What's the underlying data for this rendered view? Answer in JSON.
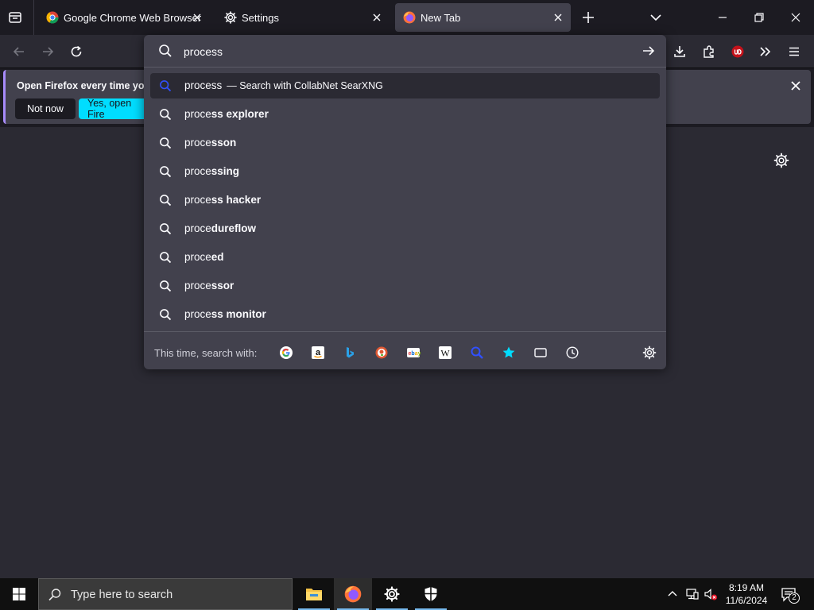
{
  "tabs": [
    {
      "title": "Google Chrome Web Browser",
      "icon": "chrome-icon",
      "active": false
    },
    {
      "title": "Settings",
      "icon": "gear-icon",
      "active": false
    },
    {
      "title": "New Tab",
      "icon": "firefox-icon",
      "active": true
    }
  ],
  "notification": {
    "message": "Open Firefox every time you",
    "not_now_label": "Not now",
    "yes_label": "Yes, open Fire"
  },
  "urlbar": {
    "value": "process",
    "suggestions": [
      {
        "typed": "process",
        "rest": "",
        "note": "— Search with CollabNet SearXNG",
        "selected": true
      },
      {
        "typed": "proce",
        "rest": "ss explorer",
        "note": ""
      },
      {
        "typed": "proce",
        "rest": "sson",
        "note": ""
      },
      {
        "typed": "proce",
        "rest": "ssing",
        "note": ""
      },
      {
        "typed": "proce",
        "rest": "ss hacker",
        "note": ""
      },
      {
        "typed": "proce",
        "rest": "dureflow",
        "note": ""
      },
      {
        "typed": "proce",
        "rest": "ed",
        "note": ""
      },
      {
        "typed": "proce",
        "rest": "ssor",
        "note": ""
      },
      {
        "typed": "proce",
        "rest": "ss monitor",
        "note": ""
      }
    ],
    "oneoff_label": "This time, search with:",
    "engines": [
      "google-icon",
      "amazon-icon",
      "bing-icon",
      "duckduckgo-icon",
      "ebay-icon",
      "wikipedia-icon",
      "searxng-icon",
      "bookmarks-icon",
      "tabs-icon",
      "history-icon"
    ]
  },
  "taskbar": {
    "search_placeholder": "Type here to search",
    "time": "8:19 AM",
    "date": "11/6/2024",
    "notification_count": "2"
  },
  "colors": {
    "accent": "#00ddff",
    "background": "#1c1b22",
    "panel": "#42414d",
    "toolbar": "#2b2a33"
  }
}
